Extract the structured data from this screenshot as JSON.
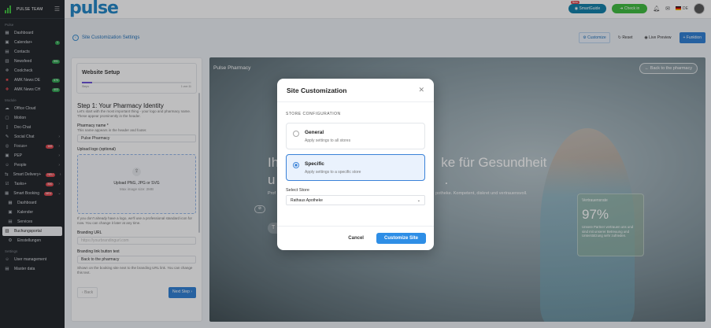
{
  "sidebar": {
    "team": "PULSE TEAM",
    "section_pulse": "Pulse",
    "items": [
      {
        "label": "Dashboard",
        "icon": "grid-icon"
      },
      {
        "label": "Calendar+",
        "badge": "1"
      },
      {
        "label": "Contacts"
      },
      {
        "label": "Newsfeed",
        "badge": "991"
      },
      {
        "label": "Coolcheck"
      },
      {
        "label": "AMK News DE",
        "badge": "470"
      },
      {
        "label": "AMK News CH",
        "badge": "403"
      }
    ],
    "section_modules": "Module",
    "modules": [
      {
        "label": "Office Cloud"
      },
      {
        "label": "Motion"
      },
      {
        "label": "Doc-Chat"
      },
      {
        "label": "Social Chat"
      },
      {
        "label": "Focus+",
        "badge": "169"
      },
      {
        "label": "PEP"
      },
      {
        "label": "People"
      },
      {
        "label": "Smart Delivery+",
        "badge": "NEU"
      },
      {
        "label": "Tasks+",
        "badge": "830"
      },
      {
        "label": "Smart Booking",
        "badge": "NEU"
      }
    ],
    "booking_sub": [
      {
        "label": "Dashboard"
      },
      {
        "label": "Kalender"
      },
      {
        "label": "Services"
      },
      {
        "label": "Buchungsportal"
      },
      {
        "label": "Einstellungen"
      }
    ],
    "section_settings": "Settings",
    "settings": [
      {
        "label": "User management"
      },
      {
        "label": "Master data"
      }
    ]
  },
  "topbar": {
    "brand": "pulse",
    "smartguide": "SmartGuide",
    "new": "New",
    "checkin": "Check in",
    "lang": "DE"
  },
  "subheader": {
    "title": "Site Customization Settings",
    "customize": "Customize",
    "reset": "Reset",
    "live_preview": "Live Preview",
    "function": "Funktion"
  },
  "setup": {
    "title": "Website Setup",
    "progress_left": "Steps",
    "progress_right": "1 von 11",
    "progress": 0.09,
    "step_title": "Step 1: Your Pharmacy Identity",
    "step_desc": "Let's start with the most important thing - your logo and pharmacy name. These appear prominently in the header.",
    "name_label": "Pharmacy name *",
    "name_hint": "This name appears in the header and footer.",
    "name_value": "Pulse Pharmacy",
    "logo_label": "Upload logo (optional)",
    "upload_text": "Upload PNG, JPG or SVG",
    "upload_hint": "Max image size: 2MB",
    "logo_note": "If you don't already have a logo, we'll use a professional standard icon for now. You can change it later at any time.",
    "branding_url_label": "Branding URL",
    "branding_url_placeholder": "https://yourbrandingurl.com",
    "branding_btn_label": "Branding link button text",
    "branding_btn_value": "Back to the pharmacy",
    "branding_btn_hint": "Shown on the booking site next to the branding URL link. You can change this text.",
    "back": "Back",
    "next": "Next Step"
  },
  "preview": {
    "name": "Pulse Pharmacy",
    "back_btn": "Back to the pharmacy",
    "hero_line1_start": "Ih",
    "hero_line1_end": "ke für Gesundheit",
    "hero_line2_start": "u",
    "hero_line2_end": ".",
    "hero_sub_start": "Prof",
    "hero_sub_end": "potheke. Kompetent, diskret und vertrauensvoll.",
    "trust_label": "Vertrauensrate",
    "trust_value": "97%",
    "trust_desc": "Unsere Partner vertrauen uns und sind mit unserer Betreuung und Unterstützung sehr zufrieden."
  },
  "modal": {
    "title": "Site Customization",
    "section": "STORE CONFIGURATION",
    "options": [
      {
        "name": "General",
        "desc": "Apply settings to all stores",
        "selected": false
      },
      {
        "name": "Specific",
        "desc": "Apply settings to a specific store",
        "selected": true
      }
    ],
    "select_label": "Select Store",
    "select_value": "Rathaus Apotheke",
    "cancel": "Cancel",
    "customize": "Customize Site"
  }
}
